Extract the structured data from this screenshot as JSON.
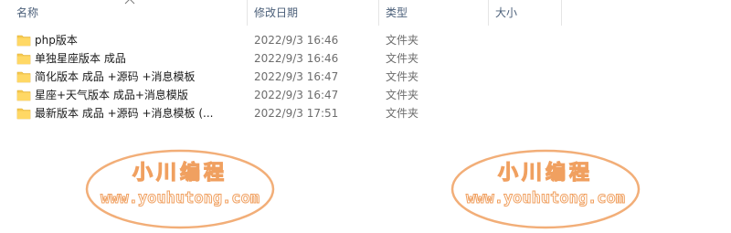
{
  "columns": {
    "name": "名称",
    "date": "修改日期",
    "type": "类型",
    "size": "大小"
  },
  "files": [
    {
      "name": "php版本",
      "date": "2022/9/3 16:46",
      "type": "文件夹",
      "icon": "folder-icon"
    },
    {
      "name": "单独星座版本  成品",
      "date": "2022/9/3 16:46",
      "type": "文件夹",
      "icon": "folder-icon"
    },
    {
      "name": "简化版本  成品 +源码  +消息模板",
      "date": "2022/9/3 16:47",
      "type": "文件夹",
      "icon": "folder-icon"
    },
    {
      "name": "星座+天气版本  成品+消息模版",
      "date": "2022/9/3 16:47",
      "type": "文件夹",
      "icon": "folder-icon"
    },
    {
      "name": "最新版本  成品 +源码  +消息模板  (...",
      "date": "2022/9/3 17:51",
      "type": "文件夹",
      "icon": "folder-icon"
    }
  ],
  "watermark": {
    "title": "小川编程",
    "url": "www.youhutong.com",
    "color": "#f0a060"
  },
  "colors": {
    "header_text": "#4c607a",
    "folder": "#f6c94f",
    "secondary_text": "#6d6d6d"
  }
}
